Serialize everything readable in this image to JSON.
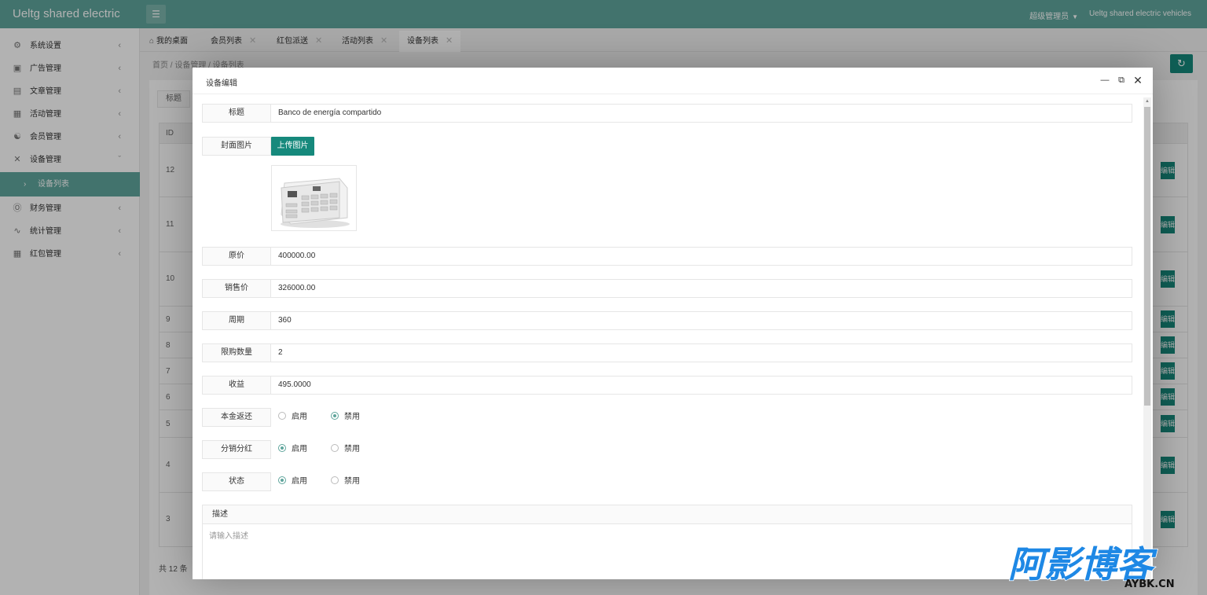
{
  "header": {
    "brand": "Ueltg shared electric",
    "menu_icon": "hamburger-icon",
    "user": "超级管理员",
    "site": "Ueltg shared electric vehicles"
  },
  "sidebar": {
    "items": [
      {
        "label": "系统设置",
        "icon": "gear-icon"
      },
      {
        "label": "广告管理",
        "icon": "image-icon"
      },
      {
        "label": "文章管理",
        "icon": "book-icon"
      },
      {
        "label": "活动管理",
        "icon": "gift-icon"
      },
      {
        "label": "会员管理",
        "icon": "user-icon"
      },
      {
        "label": "设备管理",
        "icon": "tools-icon"
      },
      {
        "label": "财务管理",
        "icon": "dollar-icon"
      },
      {
        "label": "统计管理",
        "icon": "pulse-icon"
      },
      {
        "label": "红包管理",
        "icon": "gift-icon"
      }
    ],
    "active_sub": "设备列表"
  },
  "tabs": [
    {
      "label": "我的桌面"
    },
    {
      "label": "会员列表"
    },
    {
      "label": "红包派送"
    },
    {
      "label": "活动列表"
    },
    {
      "label": "设备列表"
    }
  ],
  "content": {
    "breadcrumb": "首页 / 设备管理 / 设备列表",
    "search_label": "标题",
    "column_id": "ID",
    "row_ids": [
      "12",
      "11",
      "10",
      "9",
      "8",
      "7",
      "6",
      "5",
      "4",
      "3"
    ],
    "edit_label": "编辑",
    "total": "共 12 条"
  },
  "modal": {
    "title": "设备编辑",
    "fields": {
      "title": {
        "label": "标题",
        "value": "Banco de energía compartido"
      },
      "cover": {
        "label": "封面图片",
        "button": "上传图片"
      },
      "original_price": {
        "label": "原价",
        "value": "400000.00"
      },
      "sale_price": {
        "label": "销售价",
        "value": "326000.00"
      },
      "period": {
        "label": "周期",
        "value": "360"
      },
      "limit": {
        "label": "限购数量",
        "value": "2"
      },
      "income": {
        "label": "收益",
        "value": "495.0000"
      }
    },
    "radios": {
      "enable": "启用",
      "disable": "禁用",
      "principal_return": {
        "label": "本金返还",
        "selected": "disable"
      },
      "distribution": {
        "label": "分销分红",
        "selected": "enable"
      },
      "status": {
        "label": "状态",
        "selected": "enable"
      }
    },
    "description": {
      "label": "描述",
      "placeholder": "请输入描述"
    }
  },
  "watermark": {
    "main": "阿影博客",
    "sub": "AYBK.CN"
  },
  "colors": {
    "primary": "#5fa59c",
    "button": "#16897c",
    "watermark": "#1e88e5"
  }
}
